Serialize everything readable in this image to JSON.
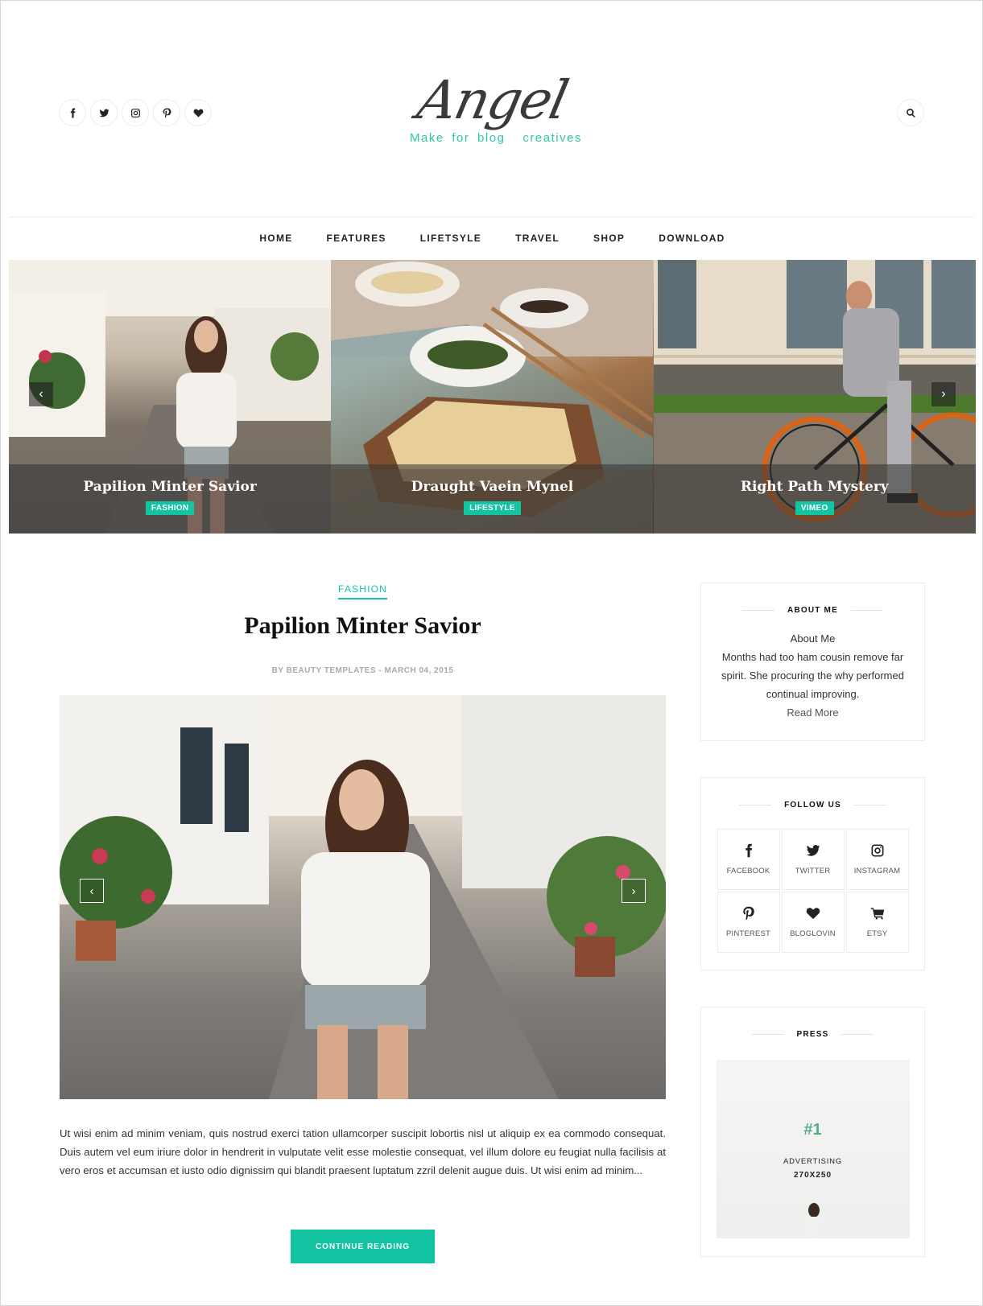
{
  "header": {
    "social_icons": [
      "facebook-icon",
      "twitter-icon",
      "instagram-icon",
      "pinterest-icon",
      "heart-icon"
    ],
    "logo": {
      "word": "Angel",
      "tagline_left": "Make for blog",
      "tagline_right": "creatives"
    },
    "search_icon": "search-icon"
  },
  "nav": [
    "HOME",
    "FEATURES",
    "LIFETSYLE",
    "TRAVEL",
    "SHOP",
    "DOWNLOAD"
  ],
  "slider": {
    "prev_label": "‹",
    "next_label": "›",
    "slides": [
      {
        "title": "Papilion Minter Savior",
        "tag": "FASHION"
      },
      {
        "title": "Draught Vaein Mynel",
        "tag": "LIFESTYLE"
      },
      {
        "title": "Right Path Mystery",
        "tag": "VIMEO"
      }
    ]
  },
  "post": {
    "category": "FASHION",
    "title": "Papilion Minter Savior",
    "meta": "BY BEAUTY TEMPLATES - MARCH 04, 2015",
    "prev_label": "‹",
    "next_label": "›",
    "excerpt": "Ut wisi enim ad minim veniam, quis nostrud exerci tation ullamcorper suscipit lobortis nisl ut aliquip ex ea commodo consequat. Duis autem vel eum iriure dolor in hendrerit in vulputate velit esse molestie consequat, vel illum dolore eu feugiat nulla facilisis at vero eros et accumsan et iusto odio dignissim qui blandit praesent luptatum zzril delenit augue duis. Ut wisi enim ad minim...",
    "button": "CONTINUE READING"
  },
  "sidebar": {
    "about": {
      "heading": "ABOUT ME",
      "title": "About Me",
      "text": "Months had too ham cousin remove far spirit. She procuring the why performed continual improving.",
      "read_more": "Read More"
    },
    "follow": {
      "heading": "FOLLOW US",
      "items": [
        {
          "label": "FACEBOOK",
          "icon": "facebook-icon"
        },
        {
          "label": "TWITTER",
          "icon": "twitter-icon"
        },
        {
          "label": "INSTAGRAM",
          "icon": "instagram-icon"
        },
        {
          "label": "PINTEREST",
          "icon": "pinterest-icon"
        },
        {
          "label": "BLOGLOVIN",
          "icon": "heart-icon"
        },
        {
          "label": "ETSY",
          "icon": "cart-icon"
        }
      ]
    },
    "press": {
      "heading": "PRESS",
      "ad_number": "#1",
      "ad_label": "ADVERTISING",
      "ad_size": "270X250"
    }
  },
  "colors": {
    "accent": "#13c4a3",
    "text": "#333333",
    "logo": "#3a3a3a"
  }
}
